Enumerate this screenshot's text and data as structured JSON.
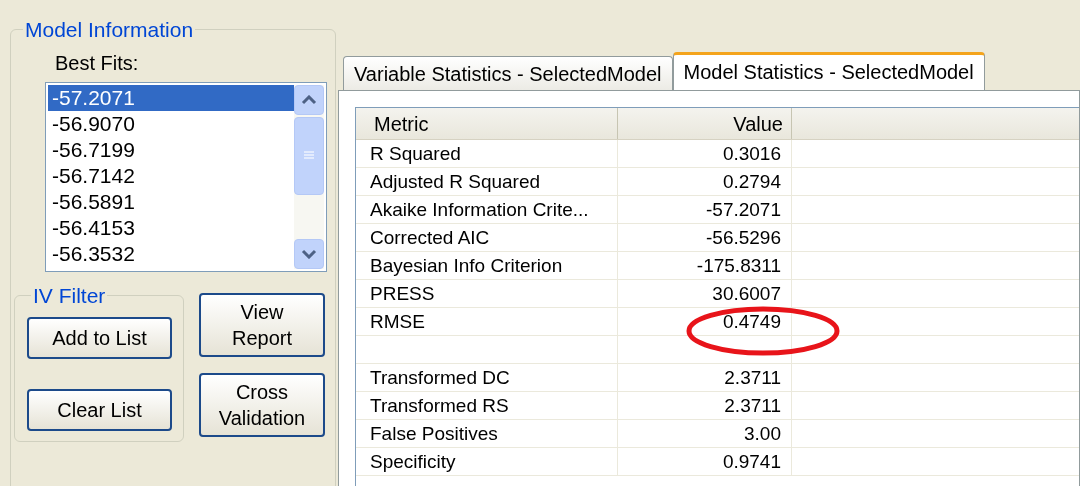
{
  "model_information": {
    "title": "Model Information",
    "best_fits": {
      "label": "Best Fits:",
      "items": [
        {
          "text": "-57.2071",
          "selected": true
        },
        {
          "text": "-56.9070",
          "selected": false
        },
        {
          "text": "-56.7199",
          "selected": false
        },
        {
          "text": "-56.7142",
          "selected": false
        },
        {
          "text": "-56.5891",
          "selected": false
        },
        {
          "text": "-56.4153",
          "selected": false
        },
        {
          "text": "-56.3532",
          "selected": false
        }
      ]
    },
    "iv_filter": {
      "title": "IV Filter",
      "buttons": [
        "Add to List",
        "Clear List"
      ]
    },
    "buttons": [
      [
        "View",
        "Report"
      ],
      [
        "Cross",
        "Validation"
      ]
    ]
  },
  "tabs": [
    {
      "label": "Variable Statistics - SelectedModel",
      "selected": false
    },
    {
      "label": "Model Statistics - SelectedModel",
      "selected": true
    }
  ],
  "table": {
    "columns": [
      "Metric",
      "Value"
    ],
    "rows": [
      {
        "kind": "data",
        "metric": "R Squared",
        "value": "0.3016"
      },
      {
        "kind": "data",
        "metric": "Adjusted R Squared",
        "value": "0.2794"
      },
      {
        "kind": "data",
        "metric": "Akaike Information Crite...",
        "value": "-57.2071"
      },
      {
        "kind": "data",
        "metric": "Corrected AIC",
        "value": "-56.5296"
      },
      {
        "kind": "data",
        "metric": "Bayesian Info Criterion",
        "value": "-175.8311"
      },
      {
        "kind": "data",
        "metric": "PRESS",
        "value": "30.6007"
      },
      {
        "kind": "data",
        "metric": "RMSE",
        "value": "0.4749"
      },
      {
        "kind": "blank"
      },
      {
        "kind": "data",
        "metric": "Transformed DC",
        "value": "2.3711"
      },
      {
        "kind": "data",
        "metric": "Transformed RS",
        "value": "2.3711"
      },
      {
        "kind": "data",
        "metric": "False Positives",
        "value": "3.00"
      },
      {
        "kind": "data",
        "metric": "Specificity",
        "value": "0.9741"
      }
    ]
  }
}
